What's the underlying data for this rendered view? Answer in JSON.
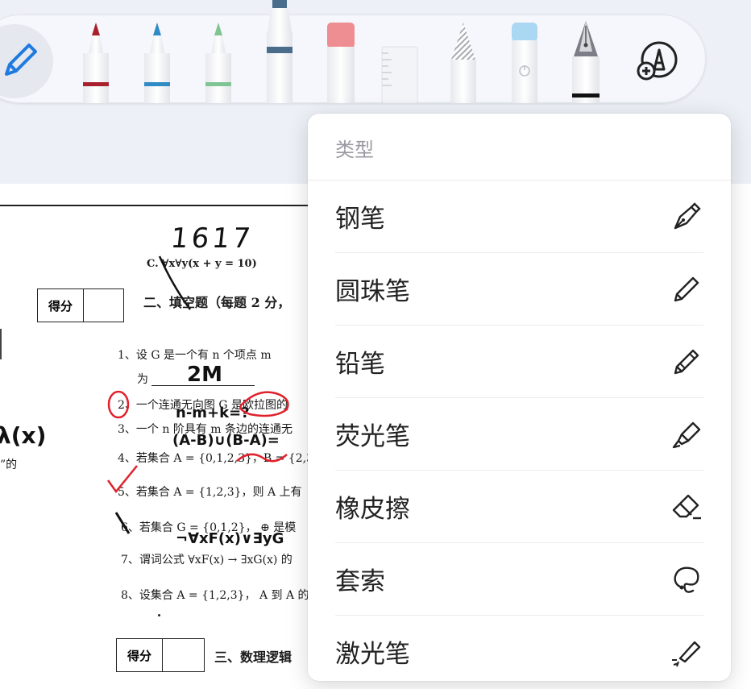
{
  "toolbar": {
    "tools": [
      {
        "name": "pen-tool",
        "icon": "pencil-icon"
      },
      {
        "name": "marker-red",
        "color": "#a8202c"
      },
      {
        "name": "marker-blue",
        "color": "#2f8bc4"
      },
      {
        "name": "marker-green",
        "color": "#7fc493"
      },
      {
        "name": "highlighter-tool",
        "color": "#4a6d8c"
      },
      {
        "name": "eraser-tool",
        "color": "#ef8e92"
      },
      {
        "name": "ruler-tool"
      },
      {
        "name": "pencil-tool"
      },
      {
        "name": "laser-tool",
        "color": "#aad7f1"
      },
      {
        "name": "fountain-pen-tool"
      },
      {
        "name": "add-tool",
        "icon": "add-tool-icon"
      }
    ]
  },
  "menu": {
    "header": "类型",
    "items": [
      {
        "label": "钢笔",
        "icon": "fountain-pen-icon"
      },
      {
        "label": "圆珠笔",
        "icon": "ballpoint-pen-icon"
      },
      {
        "label": "铅笔",
        "icon": "pencil-icon"
      },
      {
        "label": "荧光笔",
        "icon": "highlighter-icon"
      },
      {
        "label": "橡皮擦",
        "icon": "eraser-icon"
      },
      {
        "label": "套索",
        "icon": "lasso-icon"
      },
      {
        "label": "激光笔",
        "icon": "laser-pointer-icon"
      }
    ]
  },
  "document": {
    "option_c": "C. ∀x∀y(x + y = 10)",
    "score_label": "得分",
    "section2_title": "二、填空题（每题 2 分，",
    "section3_title": "三、数理逻辑",
    "questions": [
      "1、设 G 是一个有 n 个项点 m",
      "为",
      "2、一个连通无向图 G 是欧拉图的",
      "3、一个 n 阶具有 m 条边的连通无",
      "4、若集合 A = {0,1,2,3}，B = {2,3",
      "5、若集合 A = {1,2,3}，则 A 上有",
      "6、若集合 G = {0,1,2}，  ⊕ 是模",
      "7、谓词公式 ∀xF(x) → ∃xG(x) 的",
      "8、设集合 A = {1,2,3}，  A 到 A 的"
    ],
    "left_fragment": "”的",
    "handwriting": {
      "number": "1617",
      "answer1": "2M",
      "answer3": "n-m+k=?",
      "answer4": "(A-B)∪(B-A)=",
      "answer6": "¬∀xF(x)∨∃yG",
      "left": "λ(x)"
    }
  }
}
